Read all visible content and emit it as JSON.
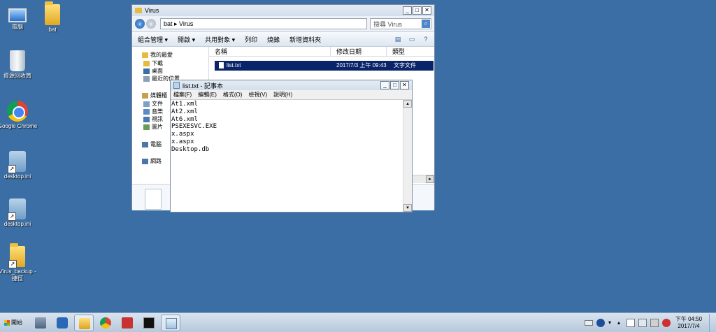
{
  "desktop": {
    "icons": [
      {
        "label": "電腦",
        "icon": "computer-icon"
      },
      {
        "label": "bat",
        "icon": "folder-icon"
      },
      {
        "label": "資源回收筒",
        "icon": "recycle-bin-icon"
      },
      {
        "label": "Google Chrome",
        "icon": "chrome-icon"
      },
      {
        "label": "desktop.ini",
        "icon": "settings-file-icon"
      },
      {
        "label": "desktop.ini",
        "icon": "settings-file-icon"
      },
      {
        "label": "Virus_backup - 捷徑",
        "icon": "folder-shortcut-icon"
      }
    ]
  },
  "explorer": {
    "title": "Virus",
    "address": "bat ▸ Virus",
    "search_placeholder": "搜尋 Virus",
    "toolbar": {
      "organize": "組合管理",
      "open": "開啟",
      "share": "共用對象",
      "print": "列印",
      "burn": "燒錄",
      "new_folder": "新增資料夾"
    },
    "nav": {
      "favorites": "我的最愛",
      "downloads": "下載",
      "desktop": "桌面",
      "recent": "最近的位置",
      "libraries": "媒體櫃",
      "documents": "文件",
      "music": "音樂",
      "videos": "視訊",
      "pictures": "圖片",
      "computer": "電腦",
      "network": "網路"
    },
    "columns": [
      "名稱",
      "修改日期",
      "類型"
    ],
    "files": [
      {
        "name": "list.txt",
        "modified": "2017/7/3 上午 09:43",
        "type": "文字文件"
      }
    ]
  },
  "notepad": {
    "title": "list.txt - 記事本",
    "menu": [
      "檔案(F)",
      "編輯(E)",
      "格式(O)",
      "檢視(V)",
      "說明(H)"
    ],
    "lines": [
      "At1.xml",
      "At2.xml",
      "At6.xml",
      "PSEXESVC.EXE",
      "x.aspx",
      "x.aspx",
      "Desktop.db"
    ]
  },
  "taskbar": {
    "start_label": "開始",
    "clock_time": "下午 04:50",
    "clock_date": "2017/7/4",
    "apps": [
      "server-manager-icon",
      "powershell-icon",
      "explorer-icon",
      "chrome-icon",
      "toolbox-icon",
      "cmd-icon",
      "notepad-icon"
    ]
  },
  "colors": {
    "desktop": "#3a6ea5",
    "selection": "#0a246a",
    "taskbar": "#c4d4e4"
  }
}
